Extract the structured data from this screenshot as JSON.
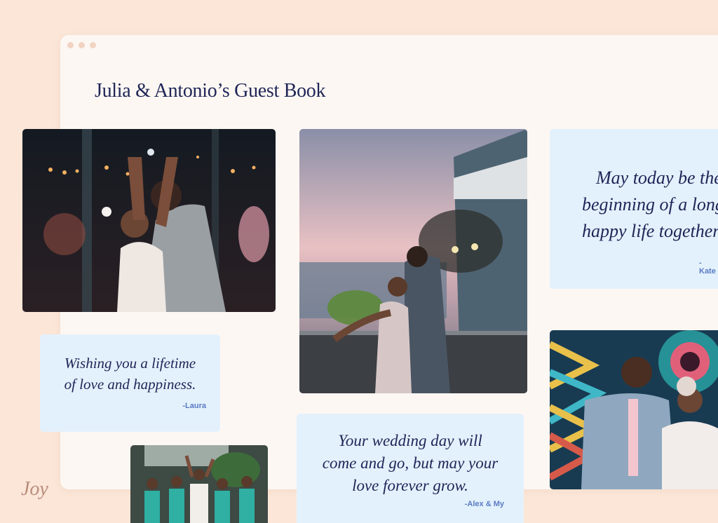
{
  "page": {
    "title": "Julia & Antonio’s Guest Book"
  },
  "brand": {
    "logo": "Joy"
  },
  "window": {
    "controls": [
      "dot",
      "dot",
      "dot"
    ]
  },
  "photos": [
    {
      "id": "dance",
      "icon": "couple-dancing-photo"
    },
    {
      "id": "sunset",
      "icon": "couple-sunset-photo"
    },
    {
      "id": "portrait",
      "icon": "couple-portrait-photo"
    },
    {
      "id": "party",
      "icon": "dance-party-photo"
    }
  ],
  "notes": [
    {
      "lines": [
        "Wishing you a lifetime",
        "of love and happiness."
      ],
      "signature": "-Laura"
    },
    {
      "lines": [
        "May today be the",
        "beginning of a long",
        "happy life together"
      ],
      "signature": "-Kate"
    },
    {
      "lines": [
        "Your wedding day will",
        "come and go, but may your",
        "love forever grow."
      ],
      "signature": "-Alex & My"
    }
  ],
  "colors": {
    "background": "#fbe6d7",
    "window": "#fdf7f3",
    "note": "#e3f1fc",
    "ink": "#1f2557",
    "signature": "#5a7bc4"
  }
}
